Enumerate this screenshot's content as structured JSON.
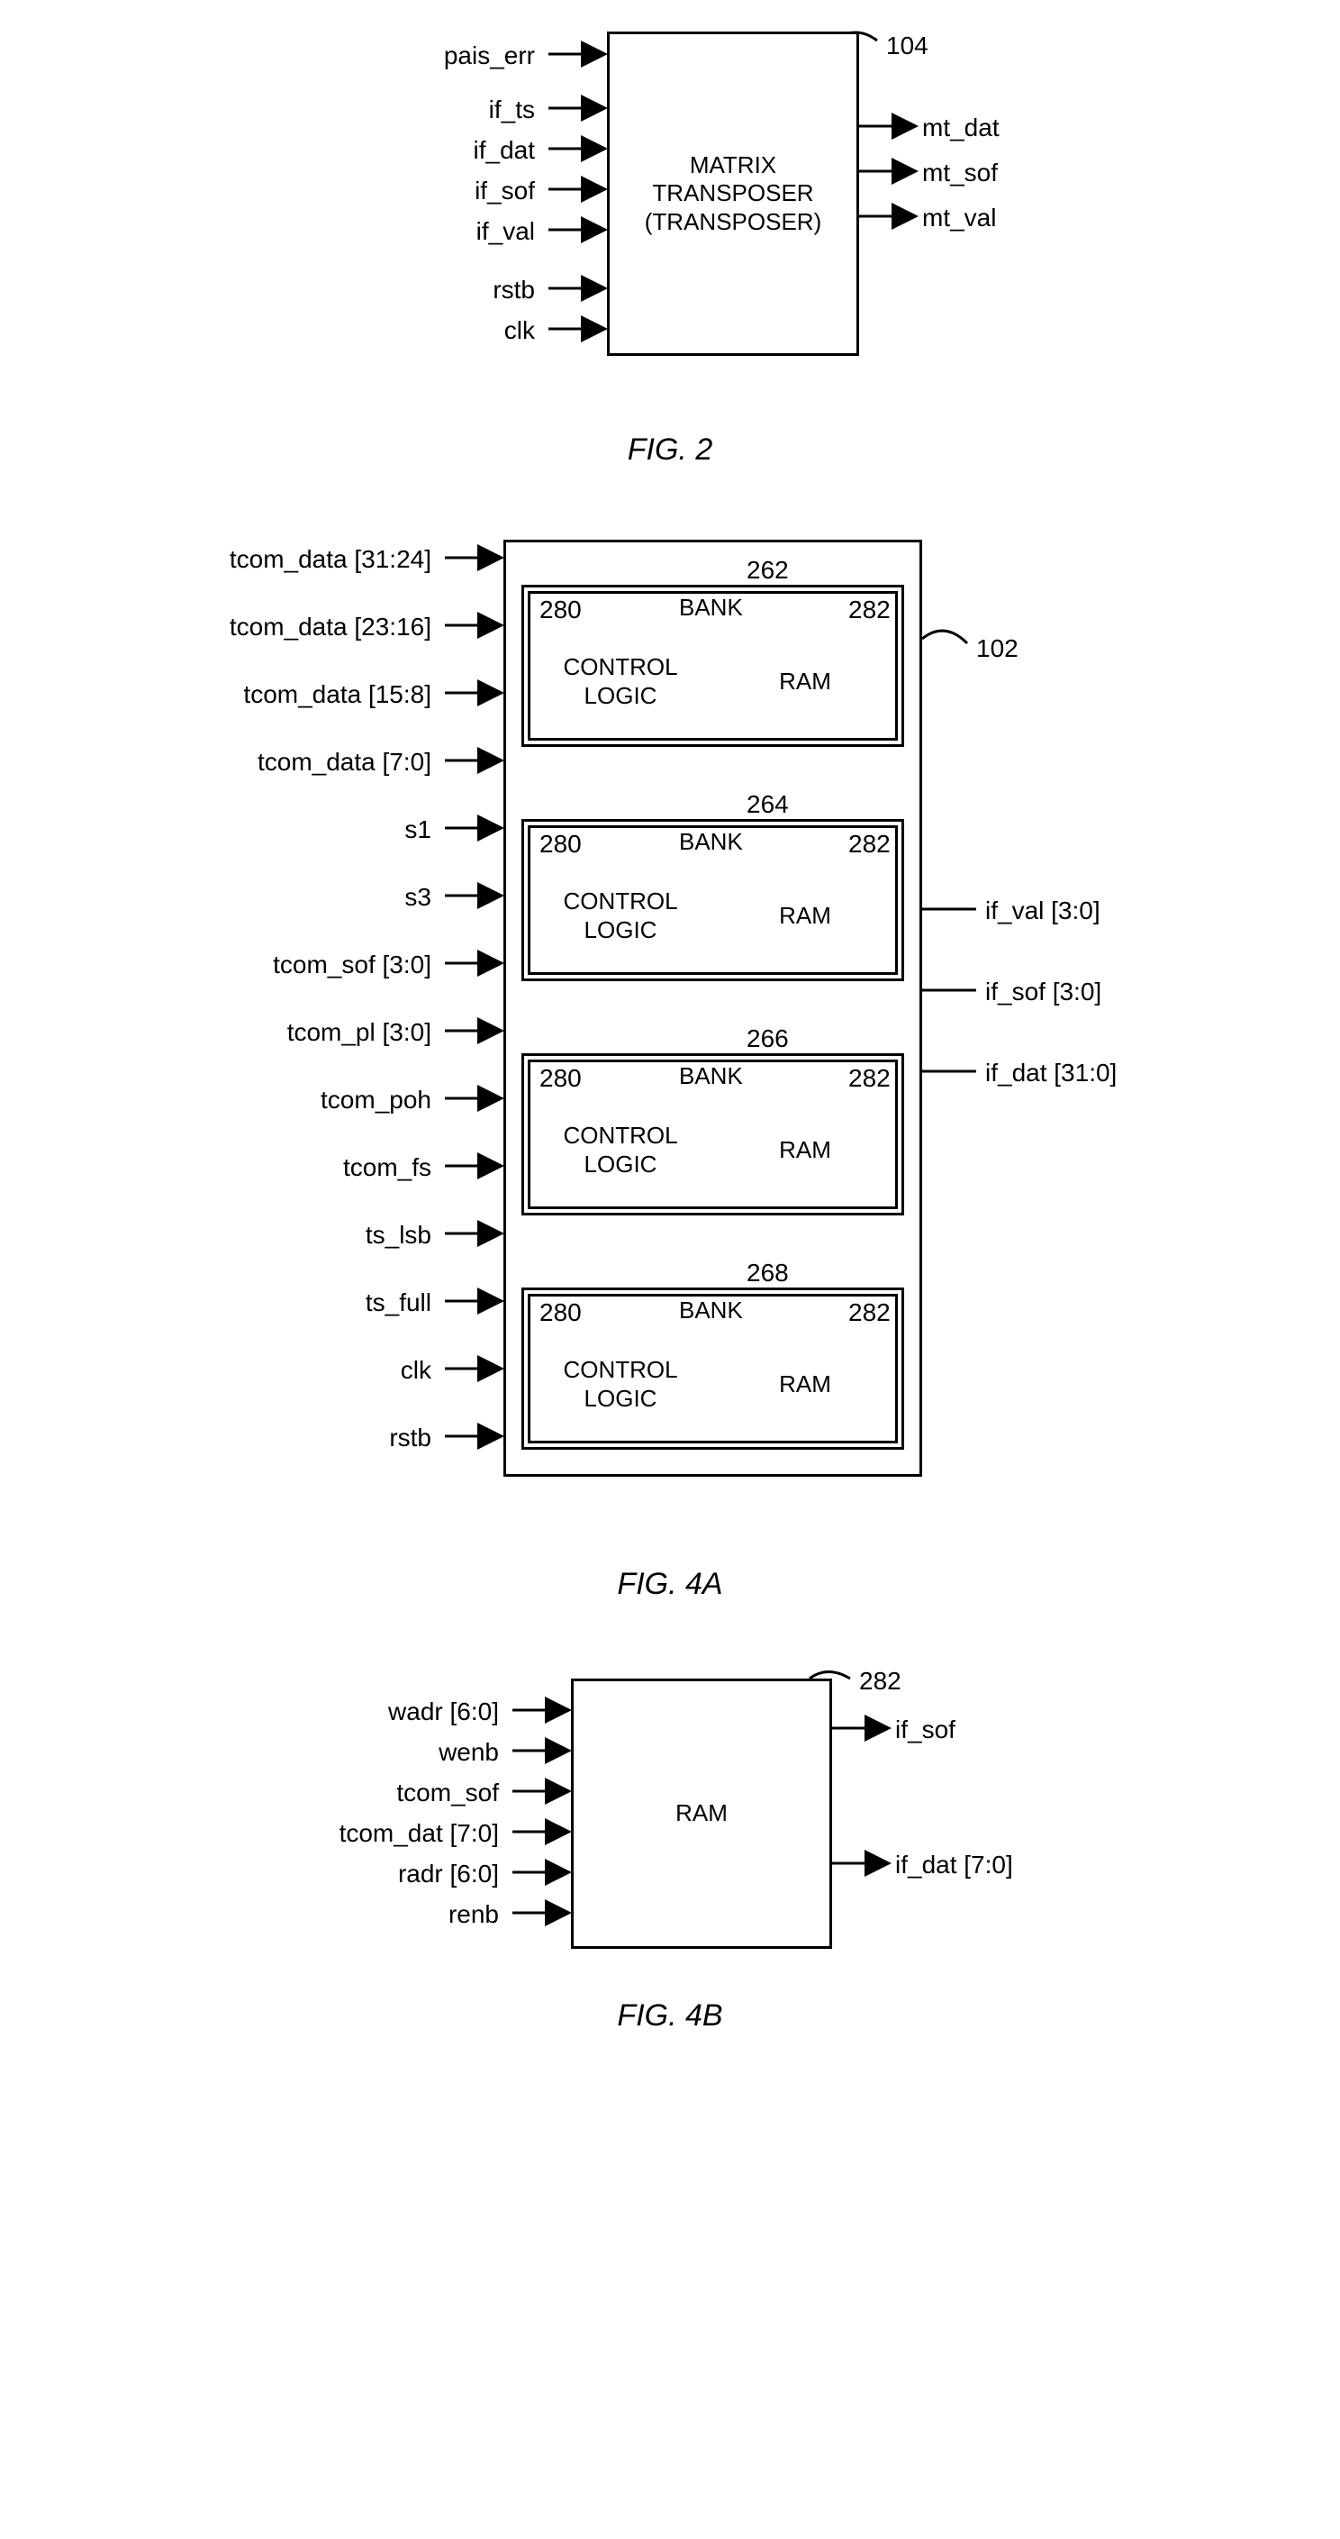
{
  "fig2": {
    "caption": "FIG. 2",
    "ref": "104",
    "block": "MATRIX\nTRANSPOSER\n(TRANSPOSER)",
    "inputs": [
      "pais_err",
      "if_ts",
      "if_dat",
      "if_sof",
      "if_val",
      "rstb",
      "clk"
    ],
    "outputs": [
      "mt_dat",
      "mt_sof",
      "mt_val"
    ]
  },
  "fig4a": {
    "caption": "FIG. 4A",
    "ref": "102",
    "bankRefs": [
      "262",
      "264",
      "266",
      "268"
    ],
    "innerRefs": {
      "ctrl": "280",
      "ram": "282"
    },
    "bankTitle": "BANK",
    "ctrlLabel": "CONTROL\nLOGIC",
    "ramLabel": "RAM",
    "inputs": [
      "tcom_data [31:24]",
      "tcom_data [23:16]",
      "tcom_data [15:8]",
      "tcom_data [7:0]",
      "s1",
      "s3",
      "tcom_sof [3:0]",
      "tcom_pl [3:0]",
      "tcom_poh",
      "tcom_fs",
      "ts_lsb",
      "ts_full",
      "clk",
      "rstb"
    ],
    "outputs": [
      "if_val [3:0]",
      "if_sof [3:0]",
      "if_dat [31:0]"
    ]
  },
  "fig4b": {
    "caption": "FIG. 4B",
    "ref": "282",
    "block": "RAM",
    "inputs": [
      "wadr [6:0]",
      "wenb",
      "tcom_sof",
      "tcom_dat [7:0]",
      "radr [6:0]",
      "renb"
    ],
    "outputs": [
      "if_sof",
      "if_dat [7:0]"
    ]
  }
}
